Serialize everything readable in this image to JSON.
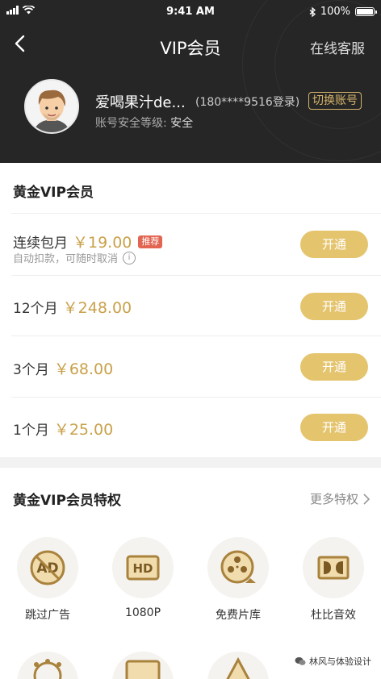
{
  "status_bar": {
    "time": "9:41 AM",
    "battery": "100%",
    "battery_level": 1.0
  },
  "nav": {
    "title": "VIP会员",
    "service": "在线客服"
  },
  "user": {
    "name": "爱喝果汁de...",
    "phone": "(180****9516登录)",
    "switch_label": "切换账号",
    "security_label": "账号安全等级:",
    "security_value": "安全"
  },
  "gold_vip": {
    "title": "黄金VIP会员",
    "plans": [
      {
        "name": "连续包月",
        "price": "￥19.00",
        "tag": "推荐",
        "sub": "自动扣款，可随时取消",
        "button": "开通"
      },
      {
        "name": "12个月",
        "price": "￥248.00",
        "button": "开通"
      },
      {
        "name": "3个月",
        "price": "￥68.00",
        "button": "开通"
      },
      {
        "name": "1个月",
        "price": "￥25.00",
        "button": "开通"
      }
    ]
  },
  "privileges": {
    "title": "黄金VIP会员特权",
    "more": "更多特权",
    "items": [
      {
        "label": "跳过广告",
        "icon": "no-ad-icon"
      },
      {
        "label": "1080P",
        "icon": "hd-icon"
      },
      {
        "label": "免费片库",
        "icon": "film-reel-icon"
      },
      {
        "label": "杜比音效",
        "icon": "dolby-icon"
      }
    ]
  },
  "watermark": "林风与体验设计",
  "colors": {
    "header_bg": "#262626",
    "gold": "#c9a14a",
    "button": "#e5c46e",
    "tag": "#e26552"
  }
}
